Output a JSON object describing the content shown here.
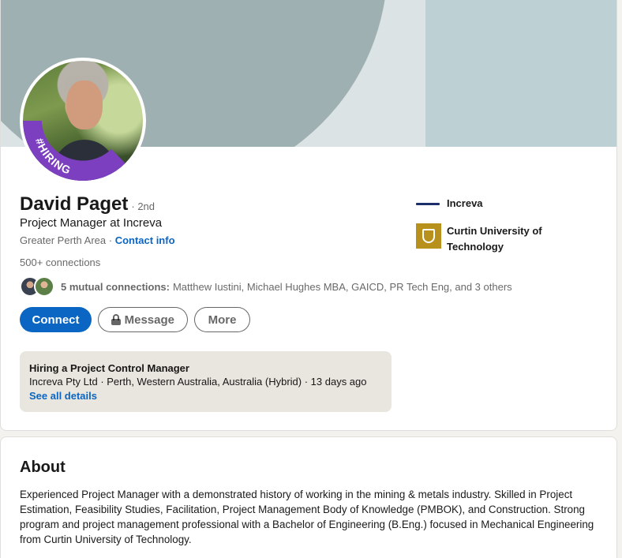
{
  "profile": {
    "name": "David Paget",
    "degree": "· 2nd",
    "headline": "Project Manager at Increva",
    "location": "Greater Perth Area",
    "location_separator": " · ",
    "contact_info": "Contact info",
    "connections": "500+ connections",
    "hiring_badge": "#HIRING"
  },
  "mutual": {
    "bold": "5 mutual connections:",
    "names": "Matthew Iustini, Michael Hughes MBA, GAICD, PR Tech Eng, and 3 others"
  },
  "actions": {
    "connect": "Connect",
    "message": "Message",
    "more": "More"
  },
  "hiring": {
    "title": "Hiring a Project Control Manager",
    "meta": "Increva Pty Ltd · Perth, Western Australia, Australia (Hybrid) · 13 days ago",
    "link": "See all details"
  },
  "orgs": [
    {
      "name": "Increva",
      "icon": "increva-logo"
    },
    {
      "name": "Curtin University of Technology",
      "icon": "curtin-logo"
    }
  ],
  "about": {
    "title": "About",
    "text": "Experienced Project Manager with a demonstrated history of working in the mining & metals industry. Skilled in Project Estimation, Feasibility Studies, Facilitation, Project Management Body of Knowledge (PMBOK), and Construction. Strong program and project management professional with a Bachelor of Engineering (B.Eng.) focused in Mechanical Engineering from Curtin University of Technology."
  },
  "colors": {
    "primary": "#0a66c2",
    "hiring_purple": "#7b3fbf"
  }
}
